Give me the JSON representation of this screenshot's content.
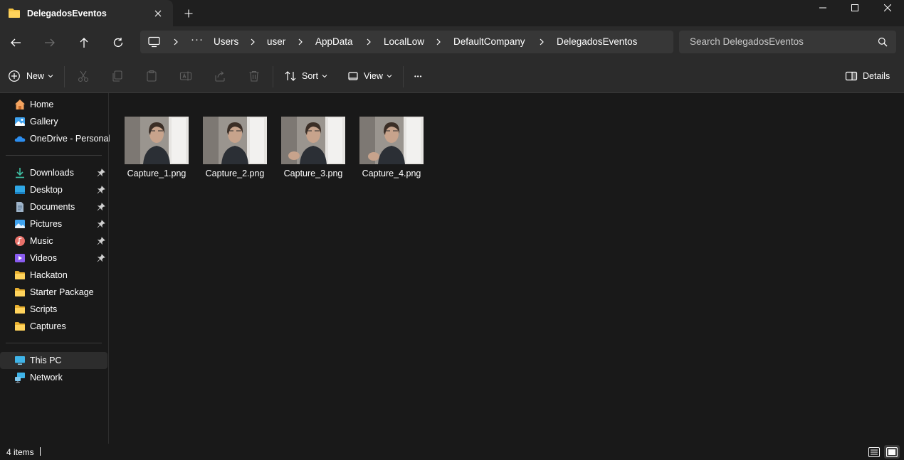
{
  "tab": {
    "title": "DelegadosEventos",
    "close_icon": "close-icon",
    "new_tab_icon": "plus-icon"
  },
  "window_controls": [
    "minimize-icon",
    "maximize-icon",
    "close-icon"
  ],
  "address": {
    "crumbs": [
      "Users",
      "user",
      "AppData",
      "LocalLow",
      "DefaultCompany",
      "DelegadosEventos"
    ],
    "overflow": "···"
  },
  "search": {
    "placeholder": "Search DelegadosEventos"
  },
  "commands": {
    "new_label": "New",
    "sort_label": "Sort",
    "view_label": "View",
    "more_label": "•••",
    "details_label": "Details"
  },
  "sidebar": {
    "top": [
      {
        "label": "Home",
        "icon": "home-icon"
      },
      {
        "label": "Gallery",
        "icon": "gallery-icon"
      },
      {
        "label": "OneDrive - Personal",
        "icon": "onedrive-icon"
      }
    ],
    "quick": [
      {
        "label": "Downloads",
        "icon": "downloads-icon",
        "pinned": true
      },
      {
        "label": "Desktop",
        "icon": "desktop-icon",
        "pinned": true
      },
      {
        "label": "Documents",
        "icon": "documents-icon",
        "pinned": true
      },
      {
        "label": "Pictures",
        "icon": "pictures-icon",
        "pinned": true
      },
      {
        "label": "Music",
        "icon": "music-icon",
        "pinned": true
      },
      {
        "label": "Videos",
        "icon": "videos-icon",
        "pinned": true
      },
      {
        "label": "Hackaton",
        "icon": "folder-icon",
        "pinned": false
      },
      {
        "label": "Starter Package",
        "icon": "folder-icon",
        "pinned": false
      },
      {
        "label": "Scripts",
        "icon": "folder-icon",
        "pinned": false
      },
      {
        "label": "Captures",
        "icon": "folder-icon",
        "pinned": false
      }
    ],
    "bottom": [
      {
        "label": "This PC",
        "icon": "this-pc-icon",
        "selected": true
      },
      {
        "label": "Network",
        "icon": "network-icon",
        "selected": false
      }
    ]
  },
  "files": [
    {
      "name": "Capture_1.png"
    },
    {
      "name": "Capture_2.png"
    },
    {
      "name": "Capture_3.png"
    },
    {
      "name": "Capture_4.png"
    }
  ],
  "status": {
    "count": "4 items"
  },
  "colors": {
    "background": "#191919",
    "toolbar": "#2b2b2b",
    "input": "#373737",
    "folder": "#f5c342",
    "accent": "#4cc2ff"
  }
}
